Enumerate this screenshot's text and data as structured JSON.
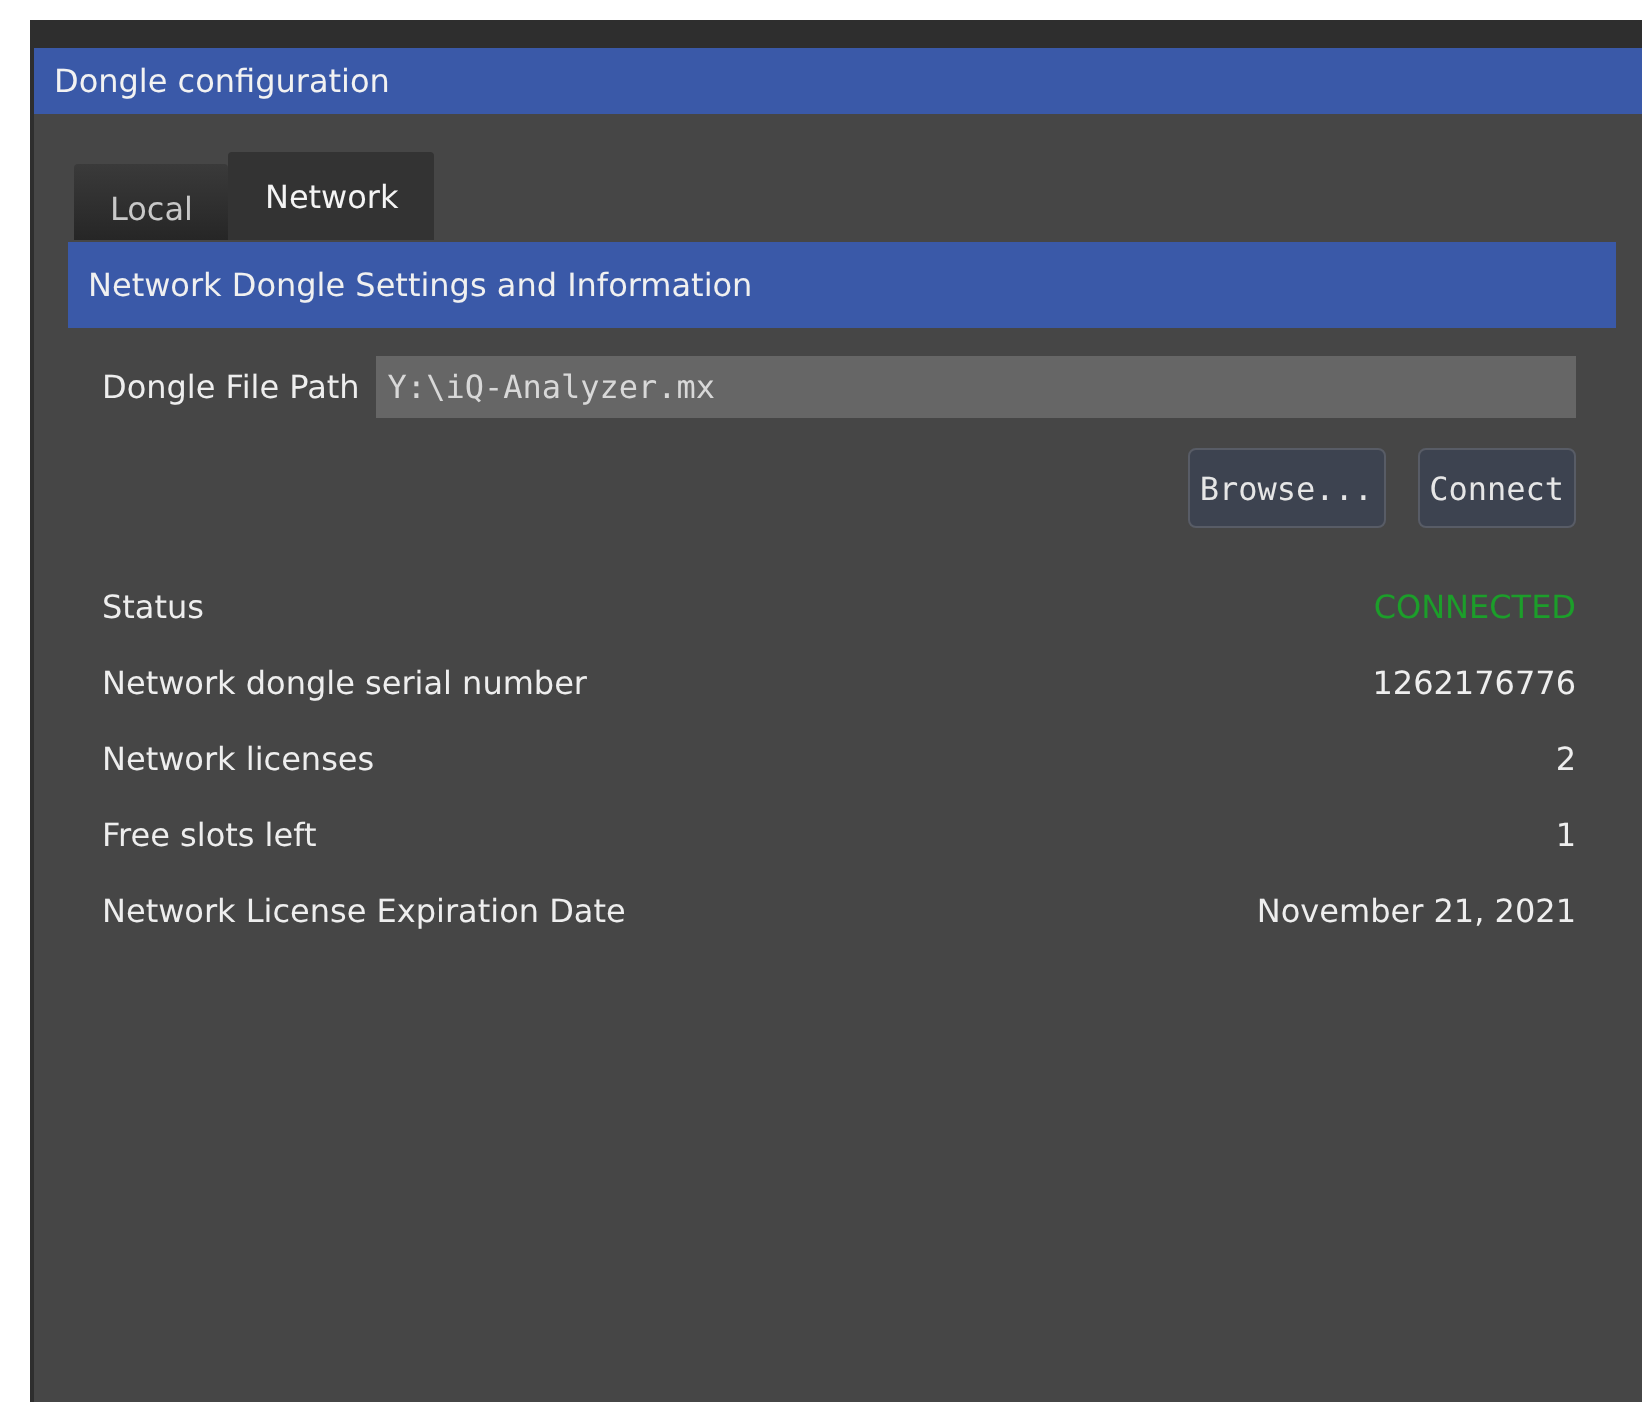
{
  "window": {
    "title": "Dongle configuration"
  },
  "tabs": [
    {
      "label": "Local",
      "selected": false
    },
    {
      "label": "Network",
      "selected": true
    }
  ],
  "section": {
    "title": "Network Dongle Settings and Information"
  },
  "path_field": {
    "label": "Dongle File Path",
    "value": "Y:\\iQ-Analyzer.mx"
  },
  "buttons": [
    "Browse...",
    "Connect"
  ],
  "rows": [
    {
      "label": "Status",
      "value": "CONNECTED",
      "color": "#1c9e2a"
    },
    {
      "label": "Network dongle serial number",
      "value": "1262176776"
    },
    {
      "label": "Network licenses",
      "value": "2"
    },
    {
      "label": "Free slots left",
      "value": "1"
    },
    {
      "label": "Network License Expiration Date",
      "value": "November 21, 2021"
    }
  ]
}
